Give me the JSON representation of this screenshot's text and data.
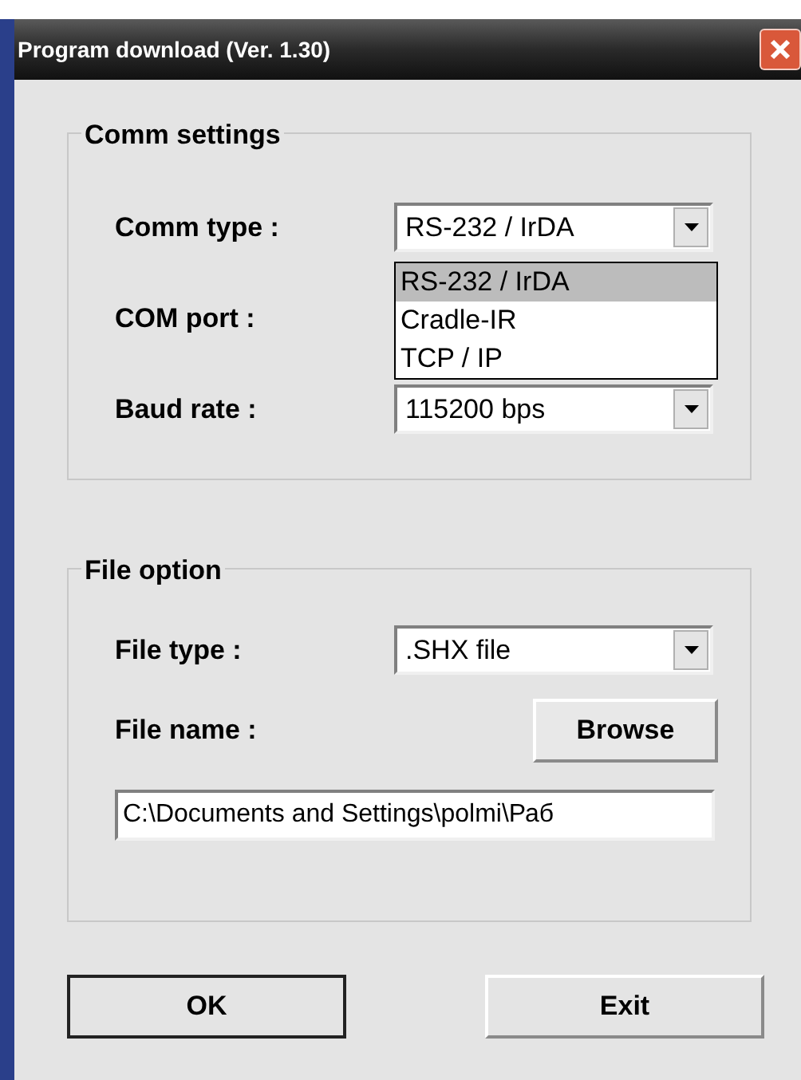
{
  "window": {
    "title": "Program download  (Ver. 1.30)"
  },
  "comm_settings": {
    "title": "Comm settings",
    "comm_type": {
      "label": "Comm type :",
      "value": "RS-232 / IrDA",
      "expanded": true,
      "options": [
        {
          "label": "RS-232 / IrDA",
          "selected": true
        },
        {
          "label": "Cradle-IR",
          "selected": false
        },
        {
          "label": "TCP / IP",
          "selected": false
        }
      ]
    },
    "com_port": {
      "label": "COM port :"
    },
    "baud_rate": {
      "label": "Baud rate :",
      "value": "115200 bps"
    }
  },
  "file_option": {
    "title": "File option",
    "file_type": {
      "label": "File type :",
      "value": ".SHX file"
    },
    "file_name": {
      "label": "File name :",
      "value": "C:\\Documents and Settings\\polmi\\Раб"
    },
    "browse_button": "Browse"
  },
  "buttons": [
    "OK",
    "Exit"
  ]
}
